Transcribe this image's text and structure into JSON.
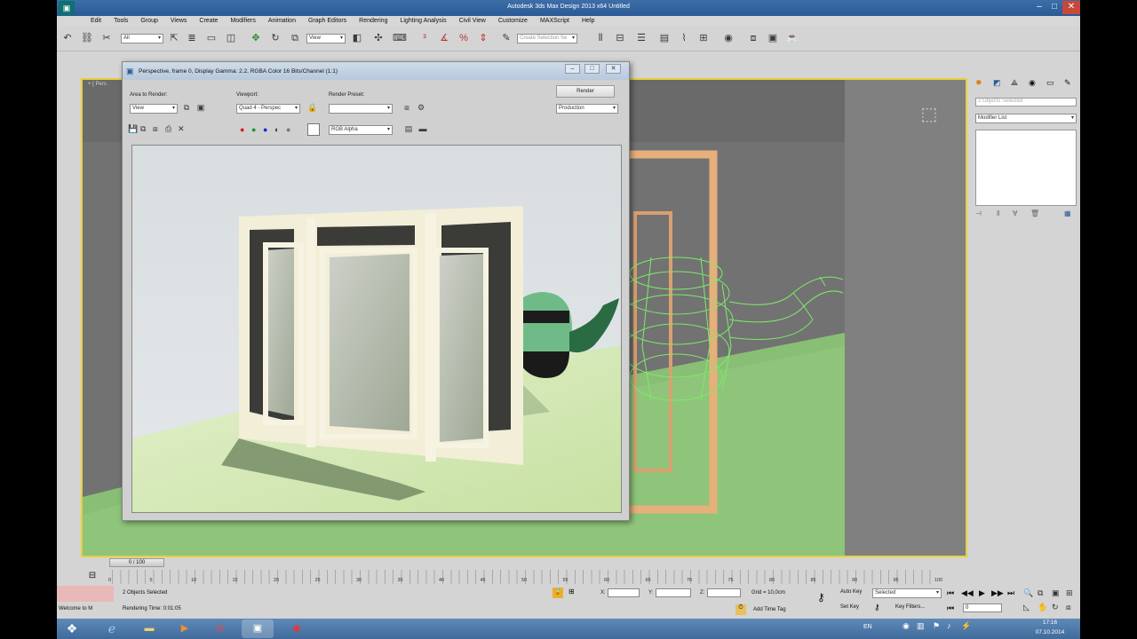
{
  "window": {
    "title": "Autodesk 3ds Max Design 2013 x64     Untitled"
  },
  "menu": [
    "Edit",
    "Tools",
    "Group",
    "Views",
    "Create",
    "Modifiers",
    "Animation",
    "Graph Editors",
    "Rendering",
    "Lighting Analysis",
    "Civil View",
    "Customize",
    "MAXScript",
    "Help"
  ],
  "toolbar": {
    "selection_filter": "All",
    "ref_coord": "View",
    "named_selection_placeholder": "Create Selection Se"
  },
  "viewport": {
    "label": "+ [ Pers",
    "colors": {
      "border": "#e8d03c",
      "wireframe": "#7dea6a",
      "floor": "#8ec57a",
      "background": "#727272"
    }
  },
  "render_frame": {
    "title": "Perspective, frame 0, Display Gamma: 2.2, RGBA Color 16 Bits/Channel (1:1)",
    "area_label": "Area to Render:",
    "area_value": "View",
    "viewport_label": "Viewport:",
    "viewport_value": "Quad 4 - Perspec",
    "preset_label": "Render Preset:",
    "preset_value": "",
    "render_button": "Render",
    "production_value": "Production",
    "channel_value": "RGB Alpha"
  },
  "command_panel": {
    "selection_name_placeholder": "2 Objects Selected",
    "modifier_list": "Modifier List"
  },
  "timeline": {
    "slider_label": "0 / 100",
    "ticks": [
      "0",
      "5",
      "10",
      "15",
      "20",
      "25",
      "30",
      "35",
      "40",
      "45",
      "50",
      "55",
      "60",
      "65",
      "70",
      "75",
      "80",
      "85",
      "90",
      "95",
      "100"
    ]
  },
  "status": {
    "welcome": "Welcome to M",
    "selection_info": "2 Objects Selected",
    "render_time": "Rendering Time: 0:01:05",
    "x_label": "X:",
    "y_label": "Y:",
    "z_label": "Z:",
    "grid": "Grid = 10,0cm",
    "add_time_tag": "Add Time Tag",
    "auto_key": "Auto Key",
    "auto_key_value": "Selected",
    "set_key": "Set Key",
    "key_filters": "Key Filters...",
    "frame_value": "0"
  },
  "taskbar": {
    "lang": "EN",
    "time": "17:16",
    "date": "07.10.2014"
  }
}
